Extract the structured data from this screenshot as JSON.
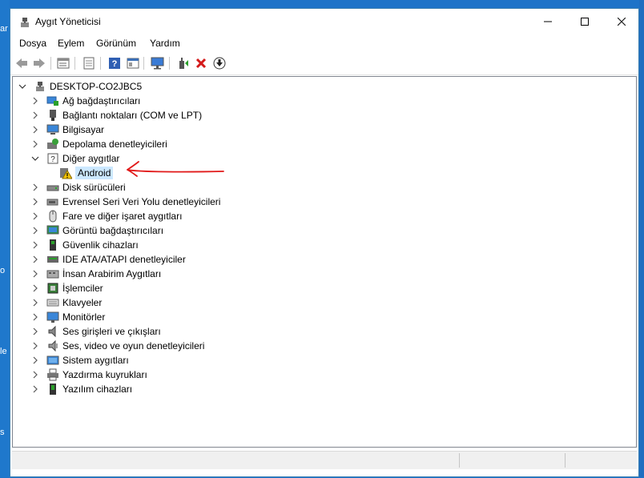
{
  "desktop": {
    "edge_texts": [
      "ar",
      "o",
      "le",
      "s"
    ]
  },
  "window": {
    "title": "Aygıt Yöneticisi",
    "controls": {
      "minimize": "—",
      "maximize": "☐",
      "close": "✕"
    }
  },
  "menu": [
    "Dosya",
    "Eylem",
    "Görünüm",
    "Yardım"
  ],
  "toolbar": [
    "back-arrow-icon",
    "forward-arrow-icon",
    "properties-icon",
    "list-view-icon",
    "help-icon",
    "show-resources-icon",
    "monitor-scan-icon",
    "update-driver-icon",
    "uninstall-icon",
    "disable-device-icon"
  ],
  "tree": {
    "root": "DESKTOP-CO2JBC5",
    "items": [
      {
        "label": "Ağ bağdaştırıcıları",
        "icon": "network-adapter-icon",
        "expanded": false
      },
      {
        "label": "Bağlantı noktaları (COM ve LPT)",
        "icon": "port-icon",
        "expanded": false
      },
      {
        "label": "Bilgisayar",
        "icon": "computer-icon",
        "expanded": false
      },
      {
        "label": "Depolama denetleyicileri",
        "icon": "storage-controller-icon",
        "expanded": false
      },
      {
        "label": "Diğer aygıtlar",
        "icon": "other-devices-icon",
        "expanded": true
      },
      {
        "label": "Android",
        "icon": "warning-device-icon",
        "child": true,
        "selected": true
      },
      {
        "label": "Disk sürücüleri",
        "icon": "disk-drive-icon",
        "expanded": false
      },
      {
        "label": "Evrensel Seri Veri Yolu denetleyicileri",
        "icon": "usb-icon",
        "expanded": false
      },
      {
        "label": "Fare ve diğer işaret aygıtları",
        "icon": "mouse-icon",
        "expanded": false
      },
      {
        "label": "Görüntü bağdaştırıcıları",
        "icon": "display-adapter-icon",
        "expanded": false
      },
      {
        "label": "Güvenlik cihazları",
        "icon": "security-device-icon",
        "expanded": false
      },
      {
        "label": "IDE ATA/ATAPI denetleyiciler",
        "icon": "ide-controller-icon",
        "expanded": false
      },
      {
        "label": "İnsan Arabirim Aygıtları",
        "icon": "hid-icon",
        "expanded": false
      },
      {
        "label": "İşlemciler",
        "icon": "processor-icon",
        "expanded": false
      },
      {
        "label": "Klavyeler",
        "icon": "keyboard-icon",
        "expanded": false
      },
      {
        "label": "Monitörler",
        "icon": "monitor-icon",
        "expanded": false
      },
      {
        "label": "Ses girişleri ve çıkışları",
        "icon": "audio-io-icon",
        "expanded": false
      },
      {
        "label": "Ses, video ve oyun denetleyicileri",
        "icon": "sound-video-icon",
        "expanded": false
      },
      {
        "label": "Sistem aygıtları",
        "icon": "system-device-icon",
        "expanded": false
      },
      {
        "label": "Yazdırma kuyrukları",
        "icon": "printer-icon",
        "expanded": false
      },
      {
        "label": "Yazılım cihazları",
        "icon": "software-device-icon",
        "expanded": false
      }
    ]
  },
  "colors": {
    "accent": "#0078d7",
    "selection": "#cce8ff",
    "annotation": "#e11919",
    "warning": "#f5c400"
  }
}
